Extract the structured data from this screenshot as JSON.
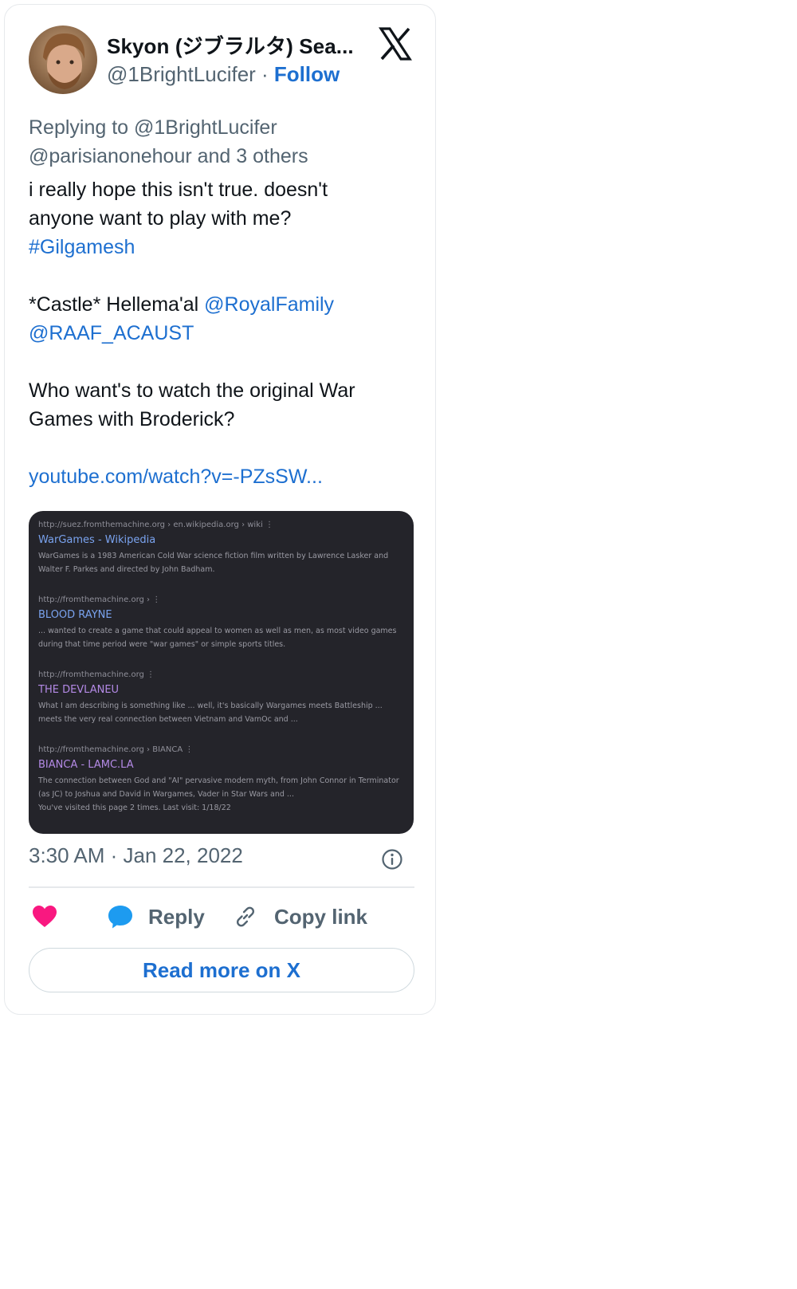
{
  "author": {
    "display_name": "Skyon (ジブラルタ) Sea...",
    "handle": "@1BrightLucifer",
    "separator": " · ",
    "follow_label": "Follow"
  },
  "tweet": {
    "replying_line1": "Replying to @1BrightLucifer",
    "replying_line2": "@parisianonehour and 3 others",
    "text_line1": "i really hope this isn't true.  doesn't",
    "text_line2": "anyone want to play with me?",
    "hashtag": "#Gilgamesh",
    "castle_text": "*Castle* Hellema'al ",
    "mention1": "@RoyalFamily",
    "mention2": "@RAAF_ACAUST",
    "question_line1": "Who want's to watch the original War",
    "question_line2": "Games with Broderick?",
    "link": "youtube.com/watch?v=-PZsSW..."
  },
  "preview": {
    "results": [
      {
        "url": "http://suez.fromthemachine.org › en.wikipedia.org › wiki   ⋮",
        "title": "WarGames - Wikipedia",
        "desc": "WarGames is a 1983 American Cold War science fiction film written by Lawrence Lasker and Walter F. Parkes and directed by John Badham."
      },
      {
        "url": "http://fromthemachine.org ›   ⋮",
        "title": "BLOOD RAYNE",
        "desc": "... wanted to create a game that could appeal to women as well as men, as most video games during that time period were \"war games\" or simple sports titles."
      },
      {
        "url": "http://fromthemachine.org   ⋮",
        "title": "THE DEVLANEU",
        "desc": "What I am describing is something like ... well, it's basically Wargames meets Battleship ... meets the very real connection between Vietnam and VamOc and ..."
      },
      {
        "url": "http://fromthemachine.org › BIANCA   ⋮",
        "title": "BIANCA - LAMC.LA",
        "desc": "The connection between God and \"AI\" pervasive modern myth, from John Connor in Terminator (as JC) to Joshua and David in Wargames, Vader in Star Wars and ...",
        "visited": "You've visited this page 2 times. Last visit: 1/18/22"
      }
    ]
  },
  "timestamp": "3:30 AM · Jan 22, 2022",
  "actions": {
    "reply_label": "Reply",
    "copy_label": "Copy link"
  },
  "read_more_label": "Read more on X",
  "colors": {
    "accent": "#1d6fd0",
    "heart": "#f91880",
    "muted": "#536471"
  }
}
